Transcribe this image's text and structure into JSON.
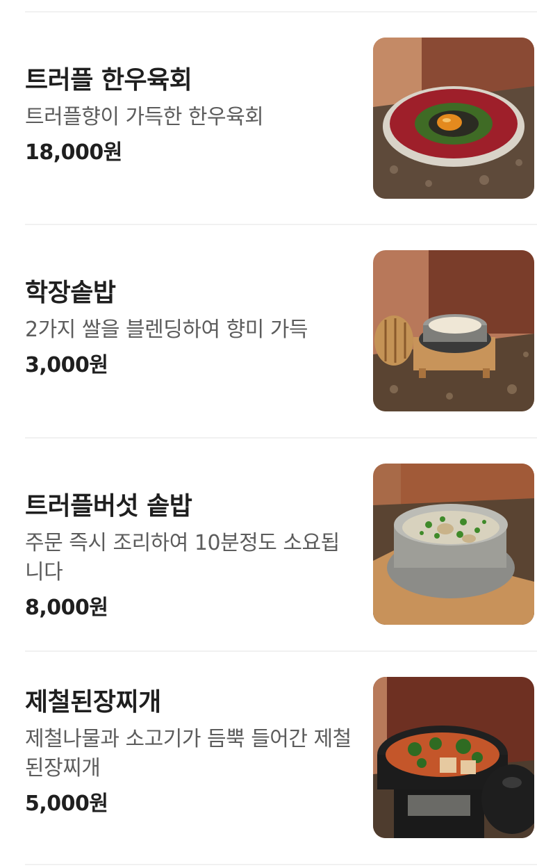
{
  "menu": {
    "items": [
      {
        "name": "트러플 한우육회",
        "description": "트러플향이 가득한 한우육회",
        "price": "18,000원",
        "image_icon": "beef-tartare-photo"
      },
      {
        "name": "학장솥밥",
        "description": "2가지 쌀을 블렌딩하여 향미 가득",
        "price": "3,000원",
        "image_icon": "pot-rice-photo"
      },
      {
        "name": "트러플버섯 솥밥",
        "description": "주문 즉시 조리하여 10분정도 소요됩니다",
        "price": "8,000원",
        "image_icon": "mushroom-pot-rice-photo"
      },
      {
        "name": "제철된장찌개",
        "description": "제철나물과 소고기가 듬뿍 들어간 제철된장찌개",
        "price": "5,000원",
        "image_icon": "soybean-stew-photo"
      }
    ]
  }
}
